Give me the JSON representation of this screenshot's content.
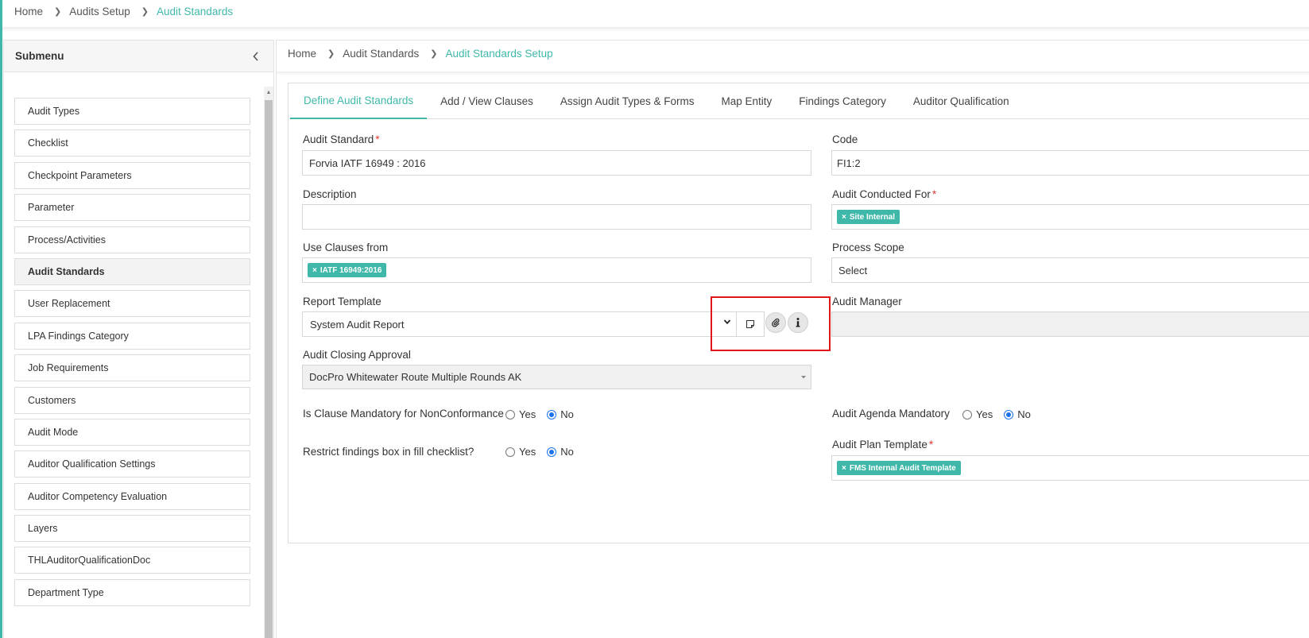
{
  "top_breadcrumb": [
    "Home",
    "Audits Setup",
    "Audit Standards"
  ],
  "sidebar": {
    "title": "Submenu",
    "items": [
      {
        "label": "Audit Types"
      },
      {
        "label": "Checklist"
      },
      {
        "label": "Checkpoint Parameters"
      },
      {
        "label": "Parameter"
      },
      {
        "label": "Process/Activities"
      },
      {
        "label": "Audit Standards"
      },
      {
        "label": "User Replacement"
      },
      {
        "label": "LPA Findings Category"
      },
      {
        "label": "Job Requirements"
      },
      {
        "label": "Customers"
      },
      {
        "label": "Audit Mode"
      },
      {
        "label": "Auditor Qualification Settings"
      },
      {
        "label": "Auditor Competency Evaluation"
      },
      {
        "label": "Layers"
      },
      {
        "label": "THLAuditorQualificationDoc"
      },
      {
        "label": "Department Type"
      }
    ]
  },
  "main_breadcrumb": [
    "Home",
    "Audit Standards",
    "Audit Standards Setup"
  ],
  "tabs": [
    {
      "label": "Define Audit Standards"
    },
    {
      "label": "Add / View Clauses"
    },
    {
      "label": "Assign Audit Types & Forms"
    },
    {
      "label": "Map Entity"
    },
    {
      "label": "Findings Category"
    },
    {
      "label": "Auditor Qualification"
    }
  ],
  "form": {
    "audit_standard": {
      "label": "Audit Standard",
      "required": "*",
      "value": "Forvia IATF 16949 : 2016"
    },
    "code": {
      "label": "Code",
      "value": "FI1:2"
    },
    "description": {
      "label": "Description",
      "value": ""
    },
    "audit_conducted_for": {
      "label": "Audit Conducted For",
      "required": "*",
      "tag": "Site Internal"
    },
    "use_clauses_from": {
      "label": "Use Clauses from",
      "tag": "IATF 16949:2016"
    },
    "process_scope": {
      "label": "Process Scope",
      "value": "Select"
    },
    "report_template": {
      "label": "Report Template",
      "value": "System Audit Report"
    },
    "audit_manager": {
      "label": "Audit Manager",
      "value": ""
    },
    "audit_closing_approval": {
      "label": "Audit Closing Approval",
      "value": "DocPro Whitewater Route Multiple Rounds AK"
    },
    "clause_mandatory": {
      "label": "Is Clause Mandatory for NonConformance",
      "yes": "Yes",
      "no": "No"
    },
    "audit_agenda_mandatory": {
      "label": "Audit Agenda Mandatory",
      "yes": "Yes",
      "no": "No"
    },
    "restrict_findings": {
      "label": "Restrict findings box in fill checklist?",
      "yes": "Yes",
      "no": "No"
    },
    "audit_plan_template": {
      "label": "Audit Plan Template",
      "required": "*",
      "tag": "FMS Internal Audit Template"
    },
    "tag_remove_symbol": "×"
  },
  "colors": {
    "accent": "#3fb8aa",
    "highlight": "#e0161a",
    "radio_checked": "#1a73e8"
  }
}
